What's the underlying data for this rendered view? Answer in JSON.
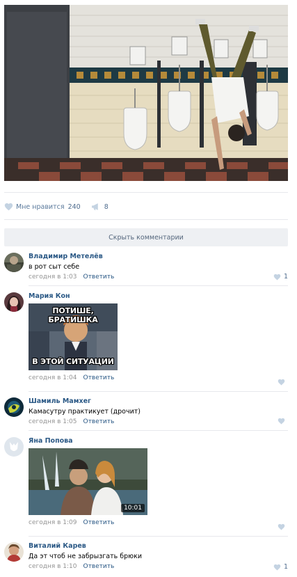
{
  "post": {
    "photo_alt": "",
    "likes_label": "Мне нравится",
    "likes_count": "240",
    "shares_count": "8",
    "hide_comments_label": "Скрыть комментарии"
  },
  "comments": [
    {
      "author": "Владимир Метелёв",
      "text": "в рот сыт себе",
      "time": "сегодня в 1:03",
      "reply_label": "Ответить",
      "likes": "1"
    },
    {
      "author": "Мария Кон",
      "text": "",
      "time": "сегодня в 1:04",
      "reply_label": "Ответить",
      "likes": "",
      "image_caption_top": "ПОТИШЕ, БРАТИШКА",
      "image_caption_bottom": "В ЭТОЙ СИТУАЦИИ"
    },
    {
      "author": "Шамиль Мамхег",
      "text": "Камасутру практикует (дрочит)",
      "time": "сегодня в 1:05",
      "reply_label": "Ответить",
      "likes": ""
    },
    {
      "author": "Яна Попова",
      "text": "",
      "time": "сегодня в 1:09",
      "reply_label": "Ответить",
      "likes": "",
      "video_duration": "10:01"
    },
    {
      "author": "Виталий Карев",
      "text": "Да эт чтоб не забрызгать брюки",
      "time": "сегодня в 1:10",
      "reply_label": "Ответить",
      "likes": "1"
    }
  ],
  "colors": {
    "link": "#2a5885",
    "meta": "#939393",
    "action": "#5b7a9c",
    "divider": "#e7e8ec",
    "button_bg": "#eef0f3"
  },
  "icons": [
    "heart-icon",
    "megaphone-icon"
  ]
}
